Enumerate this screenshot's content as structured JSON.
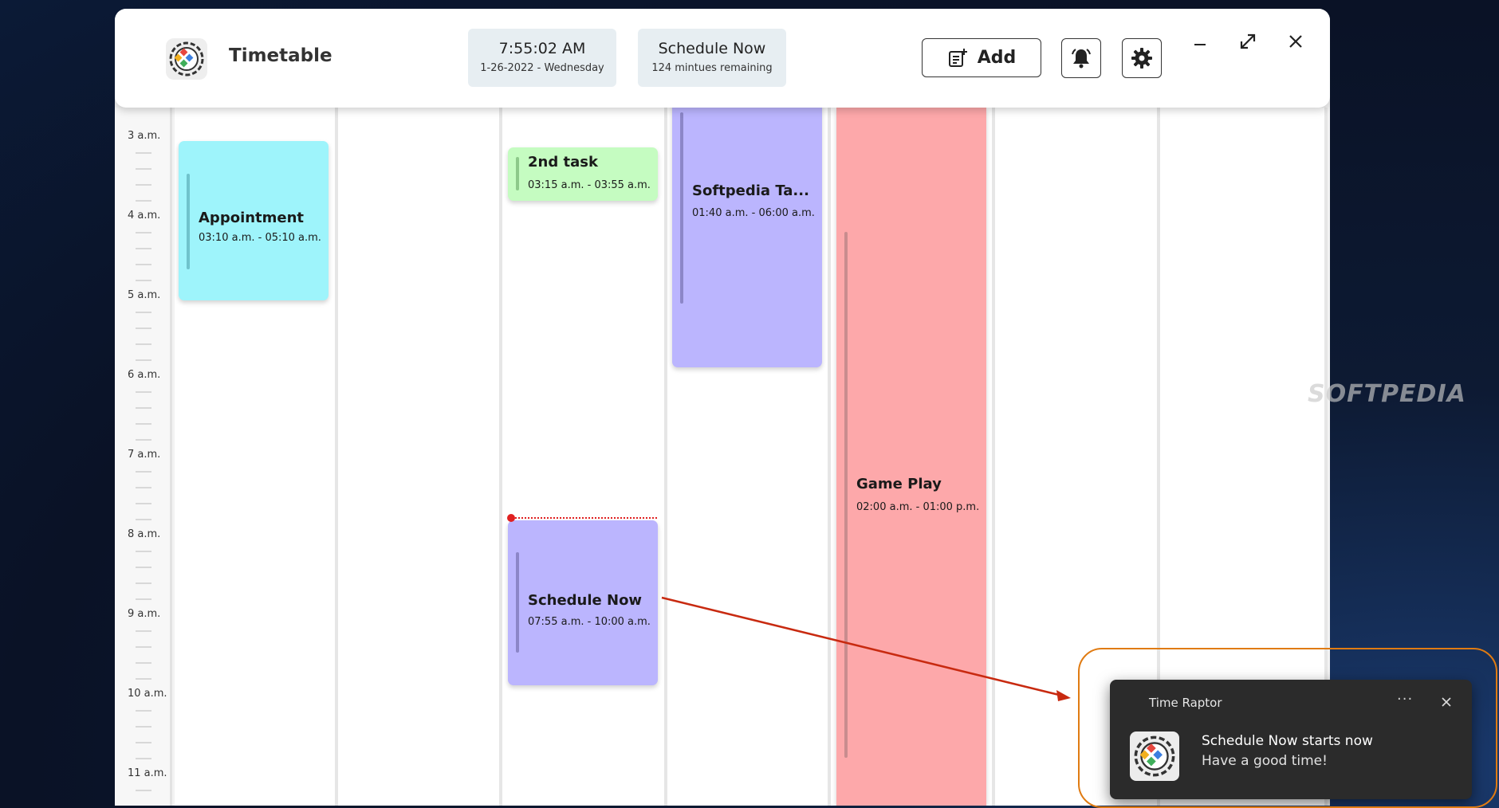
{
  "header": {
    "app_title": "Timetable",
    "clock": {
      "time": "7:55:02 AM",
      "date": "1-26-2022 - Wednesday"
    },
    "current_event": {
      "title": "Schedule Now",
      "remaining": "124 mintues remaining"
    },
    "add_label": "Add",
    "icons": {
      "logo": "app-logo-icon",
      "add": "add-note-icon",
      "bell": "bell-icon",
      "settings": "gear-icon",
      "minimize": "minimize-icon",
      "maximize": "maximize-icon",
      "close": "close-icon"
    }
  },
  "time_axis": {
    "hours": [
      "3 a.m.",
      "4 a.m.",
      "5 a.m.",
      "6 a.m.",
      "7 a.m.",
      "8 a.m.",
      "9 a.m.",
      "10 a.m.",
      "11 a.m."
    ]
  },
  "events": [
    {
      "title": "Appointment",
      "time": "03:10 a.m. - 05:10 a.m.",
      "color": "#9ef4fb"
    },
    {
      "title": "2nd task",
      "time": "03:15 a.m. - 03:55 a.m.",
      "color": "#c5fcc1"
    },
    {
      "title": "Softpedia Ta...",
      "time": "01:40 a.m. - 06:00 a.m.",
      "color": "#bbb5fe"
    },
    {
      "title": "Game Play",
      "time": "02:00 a.m. - 01:00 p.m.",
      "color": "#fda8aa"
    },
    {
      "title": "Schedule Now",
      "time": "07:55 a.m. - 10:00 a.m.",
      "color": "#bbb5fe"
    }
  ],
  "watermark": "SOFTPEDIA",
  "notification": {
    "app_name": "Time Raptor",
    "more": "···",
    "title": "Schedule Now starts now",
    "body": "Have a good time!"
  },
  "colors": {
    "now_indicator": "#e02020",
    "annotation": "#e07b12"
  }
}
